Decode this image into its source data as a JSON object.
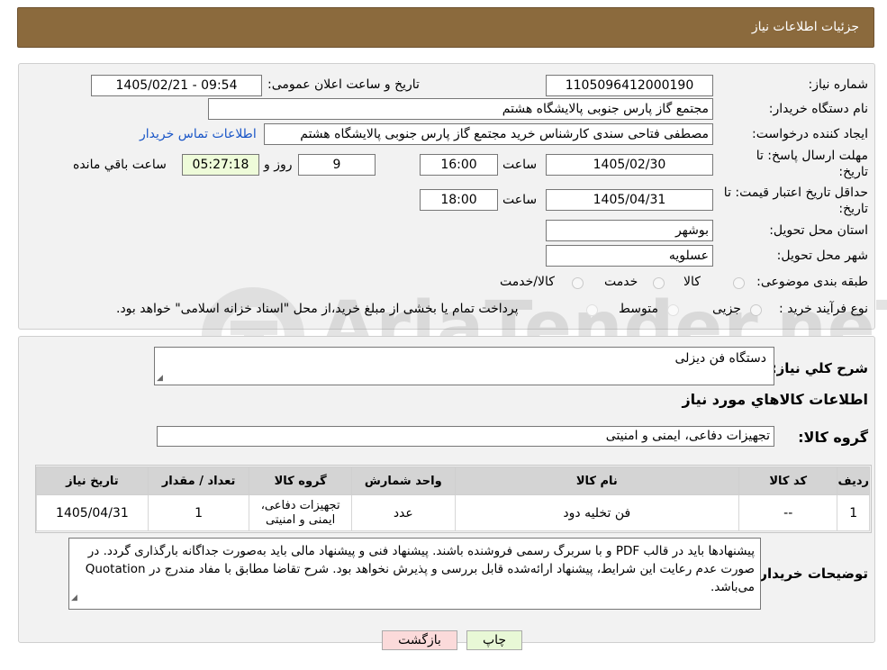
{
  "header": {
    "title": "جزئیات اطلاعات نیاز"
  },
  "fields": {
    "need_number_label": "شماره نیاز:",
    "need_number": "1105096412000190",
    "announce_label": "تاریخ و ساعت اعلان عمومی:",
    "announce_value": "1405/02/21 - 09:54",
    "buyer_org_label": "نام دستگاه خریدار:",
    "buyer_org": "مجتمع گاز پارس جنوبی  پالایشگاه هشتم",
    "requester_label": "ایجاد کننده درخواست:",
    "requester": "مصطفی فتاحی سندی کارشناس خرید مجتمع گاز پارس جنوبی  پالایشگاه هشتم",
    "contact_link": "اطلاعات تماس خریدار",
    "deadline_label_1": "مهلت ارسال پاسخ: تا",
    "deadline_label_2": "تاریخ:",
    "deadline_date": "1405/02/30",
    "time_label": "ساعت",
    "deadline_time": "16:00",
    "days_value": "9",
    "days_label": "روز و",
    "remaining_time": "05:27:18",
    "remaining_label": "ساعت باقي مانده",
    "price_validity_label_1": "حداقل تاریخ اعتبار قیمت: تا",
    "price_validity_label_2": "تاریخ:",
    "price_validity_date": "1405/04/31",
    "price_validity_time": "18:00",
    "province_label": "استان محل تحویل:",
    "province": "بوشهر",
    "city_label": "شهر محل تحویل:",
    "city": "عسلویه",
    "category_label": "طبقه بندی موضوعی:",
    "category_options": [
      "کالا",
      "خدمت",
      "کالا/خدمت"
    ],
    "process_label": "نوع فرآیند خرید :",
    "process_options": [
      "جزیی",
      "متوسط"
    ],
    "process_note": "پرداخت تمام یا بخشی از مبلغ خرید،از محل \"اسناد خزانه اسلامی\" خواهد بود."
  },
  "details": {
    "description_label": "شرح کلي نیاز:",
    "description": "دستگاه فن دیزلی",
    "goods_info_title": "اطلاعات کالاهاي مورد نیاز",
    "goods_group_label": "گروه کالا:",
    "goods_group": "تجهیزات دفاعی، ایمنی و امنیتی",
    "table": {
      "columns": [
        "ردیف",
        "کد کالا",
        "نام کالا",
        "واحد شمارش",
        "گروه کالا",
        "تعداد / مقدار",
        "تاریخ نیاز"
      ],
      "rows": [
        [
          "1",
          "--",
          "فن تخلیه دود",
          "عدد",
          "تجهیزات دفاعی، ایمنی و امنیتی",
          "1",
          "1405/04/31"
        ]
      ]
    },
    "buyer_notes_label": "توضیحات خریدار:",
    "buyer_notes": "پیشنهادها باید در قالب PDF و با سربرگ رسمی فروشنده باشند. پیشنهاد فنی و پیشنهاد مالی باید به‌صورت جداگانه بارگذاری گردد. در صورت عدم رعایت این شرایط، پیشنهاد ارائه‌شده قابل بررسی و پذیرش نخواهد بود. شرح تقاضا مطابق با مفاد مندرج در Quotation می‌باشد."
  },
  "buttons": {
    "print": "چاپ",
    "back": "بازگشت"
  },
  "watermark": {
    "text": "AriaTender.neT"
  },
  "colors": {
    "header_bg": "#8b6a3d",
    "link": "#1a56c7",
    "print_bg": "#e8f8d6",
    "back_bg": "#fbdada",
    "remaining_bg": "#eefbd9"
  }
}
